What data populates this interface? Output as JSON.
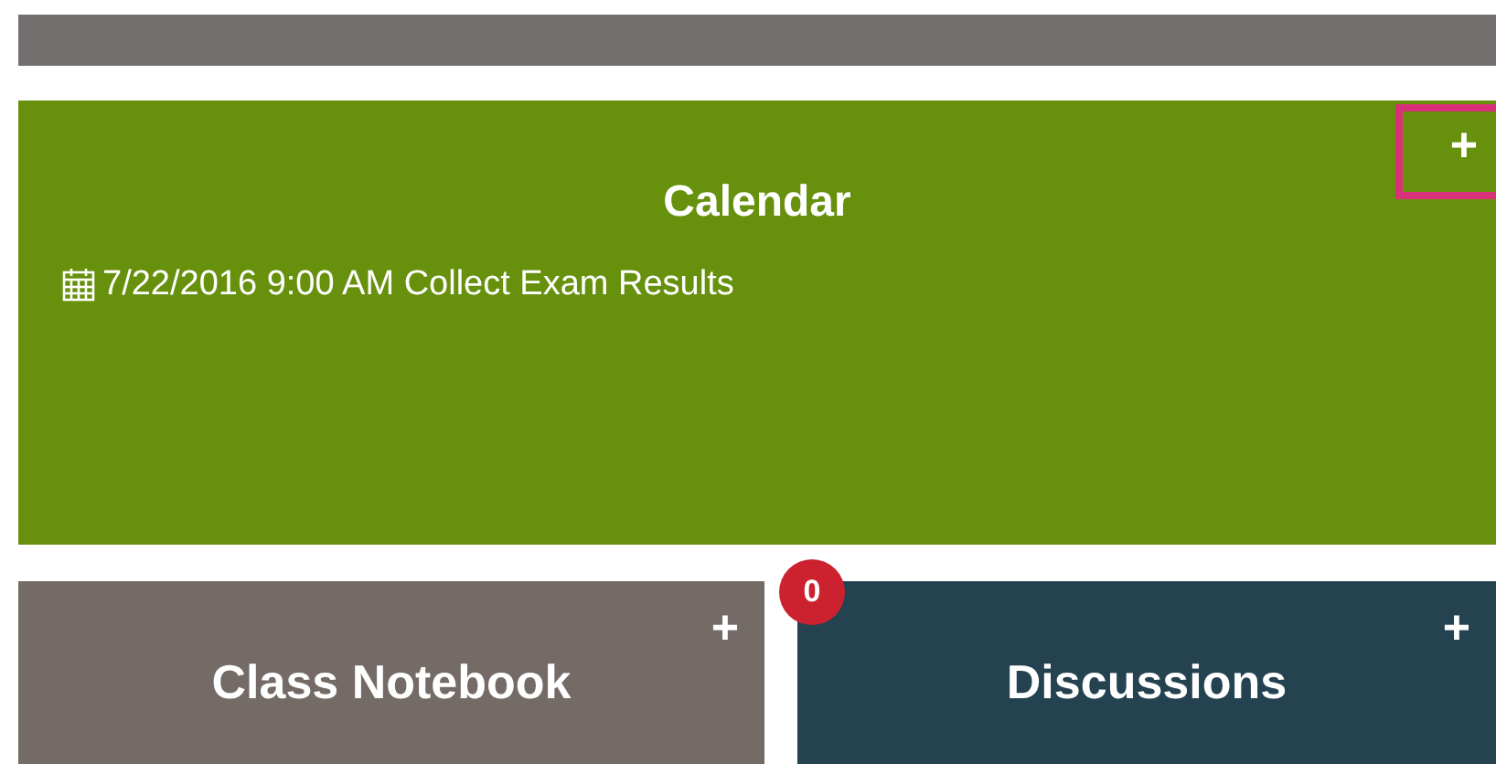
{
  "calendar": {
    "title": "Calendar",
    "add_button": {
      "label": "+",
      "focused": true
    },
    "events": [
      {
        "date": "7/22/2016",
        "time": "9:00 AM",
        "title": "Collect Exam Results"
      }
    ]
  },
  "tiles": [
    {
      "title": "Class Notebook",
      "add_label": "+",
      "color": "#746a66"
    },
    {
      "title": "Discussions",
      "add_label": "+",
      "color": "#24424f",
      "badge": "0"
    }
  ]
}
